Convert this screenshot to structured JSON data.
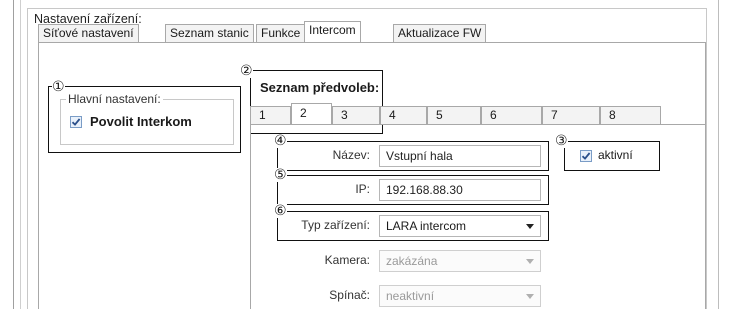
{
  "group_title": "Nastavení zařízení:",
  "main_tabs": [
    {
      "label": "Síťové nastavení"
    },
    {
      "label": "Seznam stanic"
    },
    {
      "label": "Funkce"
    },
    {
      "label": "Intercom",
      "active": true
    },
    {
      "label": "Aktualizace FW"
    }
  ],
  "main_settings": {
    "title": "Hlavní nastavení:",
    "enable_intercom": {
      "label": "Povolit Interkom",
      "checked": true
    }
  },
  "presets": {
    "title": "Seznam předvoleb:",
    "tabs": [
      "1",
      "2",
      "3",
      "4",
      "5",
      "6",
      "7",
      "8"
    ],
    "active_tab": "2"
  },
  "form": {
    "active": {
      "label": "aktivní",
      "checked": true
    },
    "name": {
      "label": "Název:",
      "value": "Vstupní hala"
    },
    "ip": {
      "label": "IP:",
      "value": "192.168.88.30"
    },
    "device_type": {
      "label": "Typ zařízení:",
      "value": "LARA intercom"
    },
    "camera": {
      "label": "Kamera:",
      "value": "zakázána",
      "disabled": true
    },
    "switch": {
      "label": "Spínač:",
      "value": "neaktivní",
      "disabled": true
    }
  },
  "callouts": [
    "①",
    "②",
    "③",
    "④",
    "⑤",
    "⑥"
  ]
}
